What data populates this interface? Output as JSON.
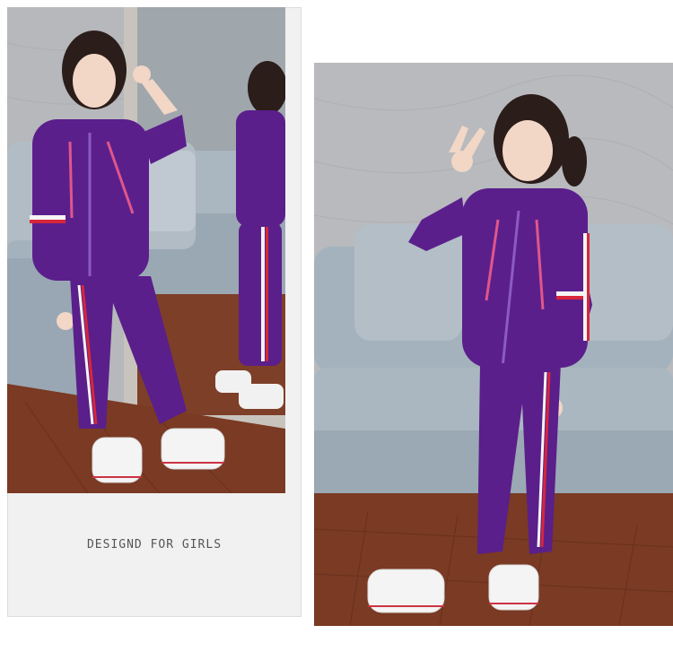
{
  "caption": "DESIGND FOR GIRLS",
  "colors": {
    "wall": "#b9bcc0",
    "sofa": "#a9b6c0",
    "floor": "#7a3a24",
    "velvet": "#5b1f8c",
    "stripe_red": "#d8263a",
    "stripe_white": "#f5f5f5",
    "frame_bg": "#f1f1f1"
  },
  "photos": {
    "left": {
      "icon": "girl-mirror-photo"
    },
    "right": {
      "icon": "girl-peace-sign-photo"
    }
  }
}
